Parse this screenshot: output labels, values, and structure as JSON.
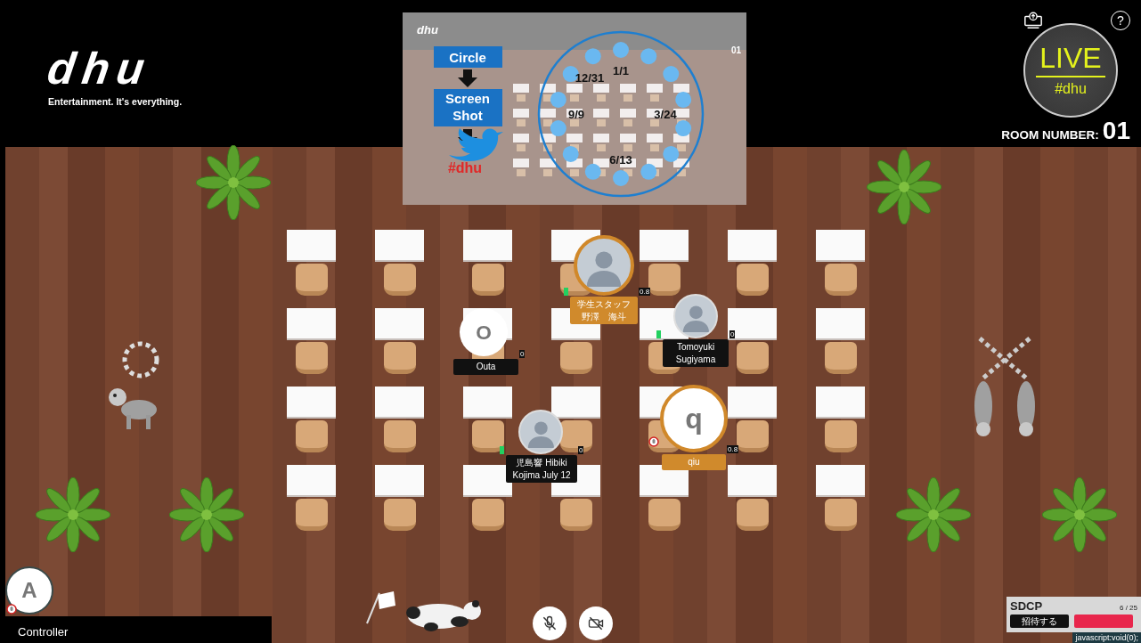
{
  "header": {
    "logo": "dhu",
    "tagline": "Entertainment. It's everything.",
    "help_glyph": "?",
    "live": {
      "title": "LIVE",
      "hashtag": "#dhu"
    },
    "room_label": "ROOM NUMBER:",
    "room_number": "01"
  },
  "shared_screen": {
    "logo": "dhu",
    "room_number": "01",
    "steps": [
      "Circle",
      "Screen Shot"
    ],
    "hashtag": "#dhu",
    "dates": [
      "12/31",
      "1/1",
      "3/24",
      "6/13",
      "9/9"
    ]
  },
  "participants": [
    {
      "kind": "video",
      "name_lines": [
        "学生スタッフ",
        "野澤　海斗"
      ],
      "volume": "0.8",
      "highlighted": true,
      "speaking": true,
      "muted": false
    },
    {
      "kind": "letter",
      "initial": "O",
      "name_lines": [
        "Outa"
      ],
      "volume": "0",
      "highlighted": false,
      "speaking": false,
      "muted": false
    },
    {
      "kind": "video",
      "name_lines": [
        "Tomoyuki",
        "Sugiyama"
      ],
      "volume": "0",
      "highlighted": false,
      "speaking": true,
      "muted": false
    },
    {
      "kind": "letter",
      "initial": "q",
      "name_lines": [
        "qiu"
      ],
      "volume": "0.8",
      "highlighted": true,
      "speaking": false,
      "muted": true
    },
    {
      "kind": "video",
      "name_lines": [
        "児島響 Hibiki",
        "Kojima July 12"
      ],
      "volume": "0",
      "highlighted": false,
      "speaking": true,
      "muted": false
    }
  ],
  "controller": {
    "initial": "A",
    "label": "Controller",
    "muted": true
  },
  "media_controls": [
    {
      "kind": "mic",
      "off": true
    },
    {
      "kind": "camera",
      "off": true
    }
  ],
  "room_panel": {
    "title": "SDCP",
    "count": "6 / 25",
    "buttons": [
      {
        "kind": "dark",
        "label": "招待する"
      },
      {
        "kind": "alert"
      }
    ]
  },
  "status_link": "javascript:void(0);"
}
